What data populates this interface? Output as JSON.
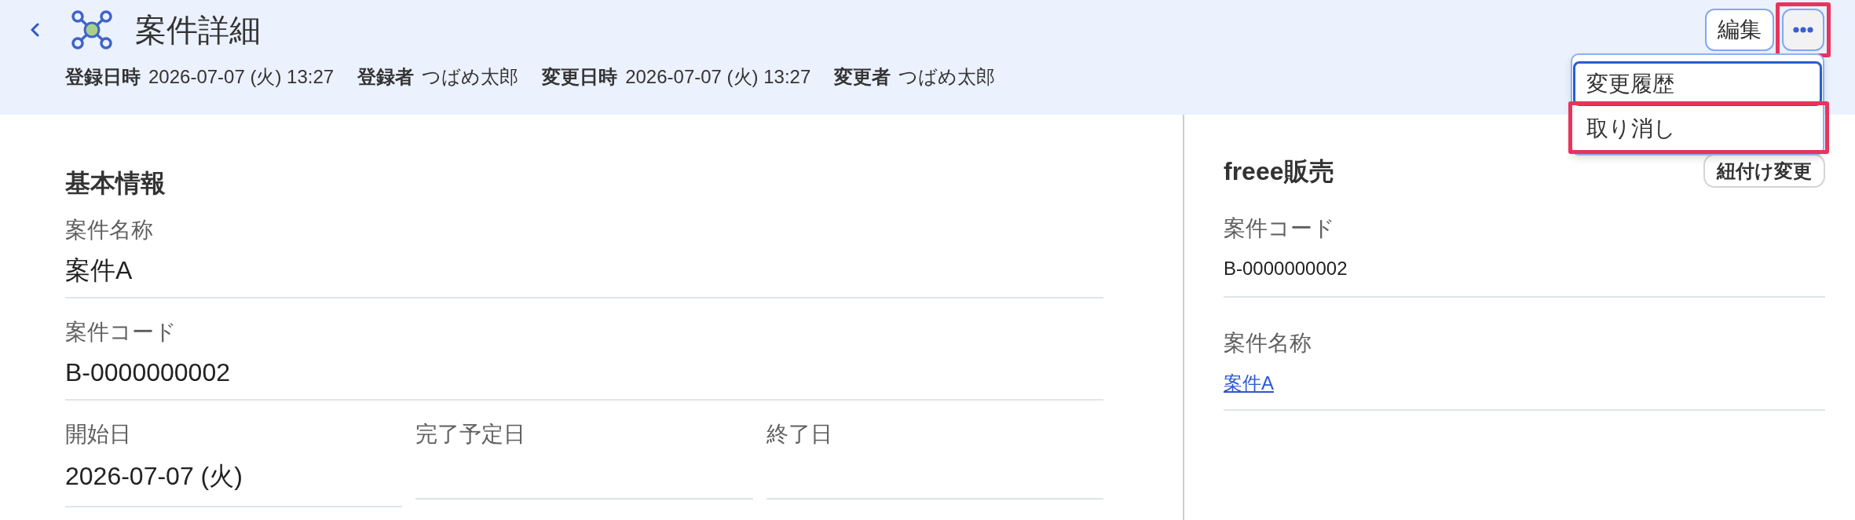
{
  "header": {
    "title": "案件詳細",
    "meta": [
      {
        "label": "登録日時",
        "value": "2026-07-07 (火) 13:27"
      },
      {
        "label": "登録者",
        "value": "つばめ太郎"
      },
      {
        "label": "変更日時",
        "value": "2026-07-07 (火) 13:27"
      },
      {
        "label": "変更者",
        "value": "つばめ太郎"
      }
    ],
    "actions": [
      {
        "kind": "text",
        "label": "編集",
        "highlighted": false
      },
      {
        "kind": "more",
        "expanded": true,
        "highlighted": true,
        "menu": {
          "items": [
            {
              "label": "変更履歴",
              "focused": true,
              "highlighted": false
            },
            {
              "label": "取り消し",
              "focused": false,
              "highlighted": true
            }
          ]
        }
      }
    ]
  },
  "basic_info": {
    "heading": "基本情報",
    "fields": [
      {
        "label": "案件名称",
        "value": "案件A"
      },
      {
        "label": "案件コード",
        "value": "B-0000000002"
      }
    ],
    "dates": [
      {
        "label": "開始日",
        "value": "2026-07-07 (火)"
      },
      {
        "label": "完了予定日"
      },
      {
        "label": "終了日"
      }
    ]
  },
  "linked_service": {
    "heading": "freee販売",
    "button": "紐付け変更",
    "fields": [
      {
        "kind": "text",
        "label": "案件コード",
        "value": "B-0000000002"
      },
      {
        "kind": "link",
        "label": "案件名称",
        "value": "案件A"
      }
    ]
  }
}
